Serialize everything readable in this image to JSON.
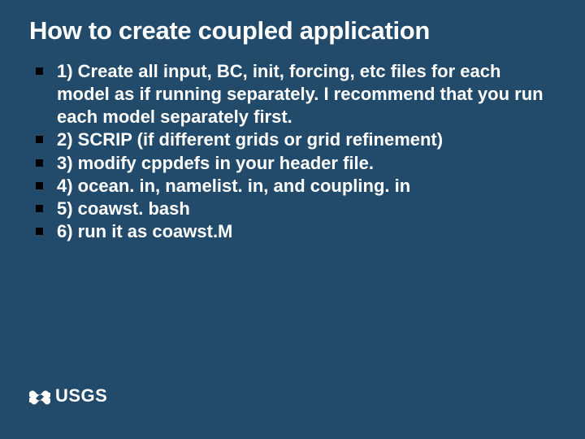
{
  "title": "How to create coupled application",
  "bullets": [
    "1) Create all input, BC, init, forcing, etc files for each model as if running separately. I recommend that you run each model separately first.",
    "2) SCRIP (if different grids or grid refinement)",
    "3) modify cppdefs in your header file.",
    "4) ocean. in, namelist. in, and coupling. in",
    "5) coawst. bash",
    "6) run it as coawst.M"
  ],
  "logo_text": "USGS"
}
